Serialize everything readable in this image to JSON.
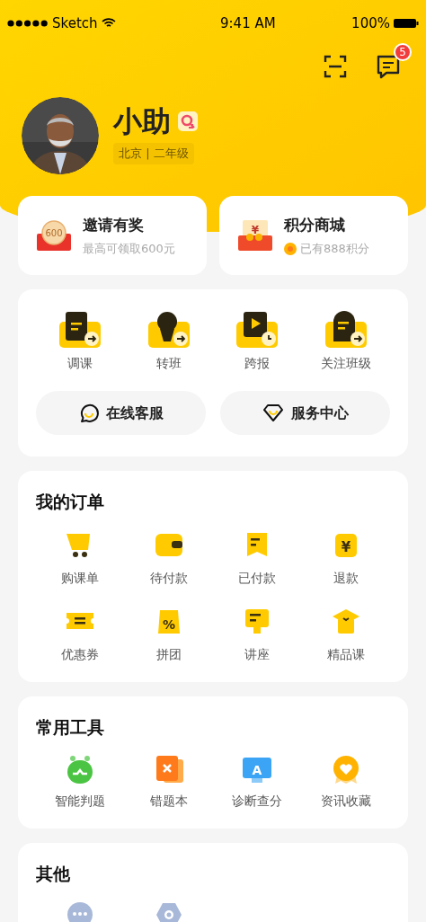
{
  "status_bar": {
    "carrier": "Sketch",
    "time": "9:41 AM",
    "battery": "100%"
  },
  "header": {
    "message_badge": "5"
  },
  "profile": {
    "name": "小助",
    "tags": "北京 | 二年级"
  },
  "promo_cards": [
    {
      "title": "邀请有奖",
      "subtitle": "最高可领取600元",
      "icon_text": "600"
    },
    {
      "title": "积分商城",
      "subtitle": "已有888积分",
      "icon_text": "¥"
    }
  ],
  "quick_actions": [
    "调课",
    "转班",
    "跨报",
    "关注班级"
  ],
  "service_buttons": [
    "在线客服",
    "服务中心"
  ],
  "orders": {
    "title": "我的订单",
    "items": [
      {
        "label": "购课单"
      },
      {
        "label": "待付款"
      },
      {
        "label": "已付款"
      },
      {
        "label": "退款",
        "glyph": "¥"
      },
      {
        "label": "优惠券"
      },
      {
        "label": "拼团",
        "glyph": "%"
      },
      {
        "label": "讲座"
      },
      {
        "label": "精品课"
      }
    ]
  },
  "tools": {
    "title": "常用工具",
    "items": [
      {
        "label": "智能判题"
      },
      {
        "label": "错题本"
      },
      {
        "label": "诊断查分",
        "glyph": "A"
      },
      {
        "label": "资讯收藏"
      }
    ]
  },
  "others": {
    "title": "其他"
  }
}
